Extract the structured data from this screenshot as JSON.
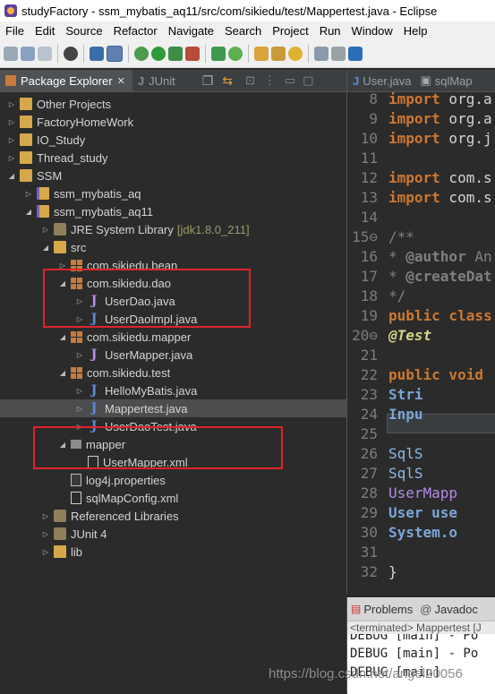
{
  "window": {
    "title": "studyFactory - ssm_mybatis_aq11/src/com/sikiedu/test/Mappertest.java - Eclipse"
  },
  "menu": [
    "File",
    "Edit",
    "Source",
    "Refactor",
    "Navigate",
    "Search",
    "Project",
    "Run",
    "Window",
    "Help"
  ],
  "explorer": {
    "tab_active": "Package Explorer",
    "tab_inactive": "JUnit",
    "tree": [
      {
        "label": "Other Projects",
        "depth": 0,
        "icon": "folder-icon",
        "expanded": false
      },
      {
        "label": "FactoryHomeWork",
        "depth": 0,
        "icon": "folder-icon",
        "expanded": false
      },
      {
        "label": "IO_Study",
        "depth": 0,
        "icon": "folder-icon",
        "expanded": false
      },
      {
        "label": "Thread_study",
        "depth": 0,
        "icon": "folder-icon",
        "expanded": false
      },
      {
        "label": "SSM",
        "depth": 0,
        "icon": "folder-icon",
        "expanded": true
      },
      {
        "label": "ssm_mybatis_aq",
        "depth": 1,
        "icon": "project-icon",
        "expanded": false
      },
      {
        "label": "ssm_mybatis_aq11",
        "depth": 1,
        "icon": "project-icon",
        "expanded": true
      },
      {
        "label": "JRE System Library",
        "decor": "[jdk1.8.0_211]",
        "depth": 2,
        "icon": "library-icon",
        "expanded": false
      },
      {
        "label": "src",
        "depth": 2,
        "icon": "source-folder-icon",
        "expanded": true
      },
      {
        "label": "com.sikiedu.bean",
        "depth": 3,
        "icon": "package-icon",
        "expanded": false
      },
      {
        "label": "com.sikiedu.dao",
        "depth": 3,
        "icon": "package-icon",
        "expanded": true
      },
      {
        "label": "UserDao.java",
        "depth": 4,
        "icon": "interface-file-icon",
        "expanded": false
      },
      {
        "label": "UserDaoImpl.java",
        "depth": 4,
        "icon": "java-file-icon",
        "expanded": false
      },
      {
        "label": "com.sikiedu.mapper",
        "depth": 3,
        "icon": "package-icon",
        "expanded": true
      },
      {
        "label": "UserMapper.java",
        "depth": 4,
        "icon": "interface-file-icon",
        "expanded": false
      },
      {
        "label": "com.sikiedu.test",
        "depth": 3,
        "icon": "package-icon",
        "expanded": true
      },
      {
        "label": "HelloMyBatis.java",
        "depth": 4,
        "icon": "java-file-icon",
        "expanded": false
      },
      {
        "label": "Mappertest.java",
        "depth": 4,
        "icon": "java-file-icon",
        "expanded": false,
        "selected": true
      },
      {
        "label": "UserDaoTest.java",
        "depth": 4,
        "icon": "java-file-icon",
        "expanded": false
      },
      {
        "label": "mapper",
        "depth": 3,
        "icon": "mapper-folder-icon",
        "expanded": true
      },
      {
        "label": "UserMapper.xml",
        "depth": 4,
        "icon": "xml-file-icon",
        "leaf": true
      },
      {
        "label": "log4j.properties",
        "depth": 3,
        "icon": "properties-file-icon",
        "leaf": true
      },
      {
        "label": "sqlMapConfig.xml",
        "depth": 3,
        "icon": "xml-file-icon",
        "leaf": true
      },
      {
        "label": "Referenced Libraries",
        "depth": 2,
        "icon": "library-icon",
        "expanded": false
      },
      {
        "label": "JUnit 4",
        "depth": 2,
        "icon": "library-icon",
        "expanded": false
      },
      {
        "label": "lib",
        "depth": 2,
        "icon": "folder-icon",
        "expanded": false
      }
    ]
  },
  "editor": {
    "tabs": [
      "User.java",
      "sqlMap"
    ],
    "lines": [
      {
        "n": "8",
        "text": "import org.a"
      },
      {
        "n": "9",
        "text": "import org.a"
      },
      {
        "n": "10",
        "text": "import org.j"
      },
      {
        "n": "11",
        "text": ""
      },
      {
        "n": "12",
        "text": "import com.s"
      },
      {
        "n": "13",
        "text": "import com.s"
      },
      {
        "n": "14",
        "text": ""
      },
      {
        "n": "15⊖",
        "text": "/**"
      },
      {
        "n": "16",
        "text": " * @author An"
      },
      {
        "n": "17",
        "text": " * @createDat"
      },
      {
        "n": "18",
        "text": " */"
      },
      {
        "n": "19",
        "text": "public class"
      },
      {
        "n": "20⊖",
        "text": "    @Test"
      },
      {
        "n": "21",
        "text": ""
      },
      {
        "n": "22",
        "text": "public void"
      },
      {
        "n": "23",
        "text": "        Stri"
      },
      {
        "n": "24",
        "text": "        Inpu"
      },
      {
        "n": "25",
        "text": ""
      },
      {
        "n": "26",
        "text": "        SqlS"
      },
      {
        "n": "27",
        "text": "        SqlS"
      },
      {
        "n": "28",
        "text": "    UserMapp"
      },
      {
        "n": "29",
        "text": "    User use"
      },
      {
        "n": "30",
        "text": "    System.o"
      },
      {
        "n": "31",
        "text": ""
      },
      {
        "n": "32",
        "text": "}"
      }
    ]
  },
  "console": {
    "tabs": [
      "Problems",
      "Javadoc"
    ],
    "status": "<terminated> Mappertest [J",
    "lines": [
      "DEBUG [main] - Po",
      "DEBUG [main] - Po",
      "DEBUG [main]"
    ]
  },
  "watermark": "https://blog.csdn.net/angel20056"
}
